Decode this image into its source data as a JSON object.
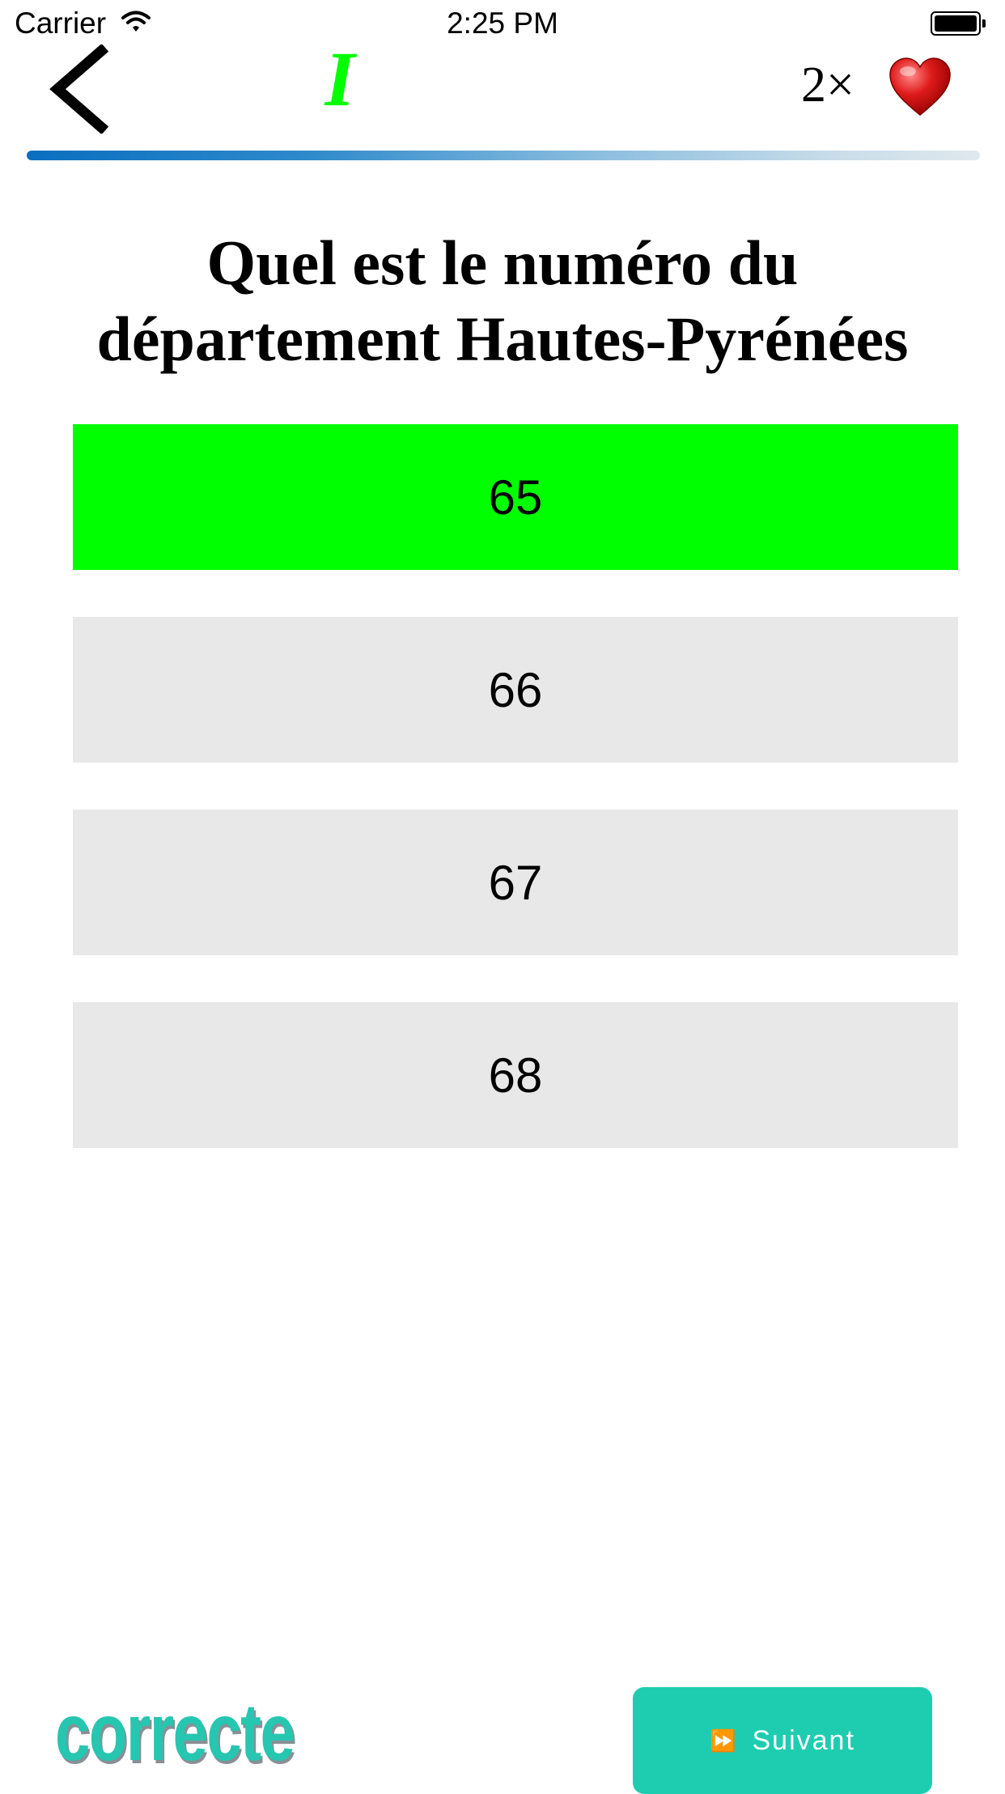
{
  "status_bar": {
    "carrier": "Carrier",
    "time": "2:25 PM"
  },
  "header": {
    "level": "I",
    "lives": "2×"
  },
  "quiz": {
    "question_lines": [
      "Quel est le numéro du",
      "département Hautes-Pyrénées"
    ],
    "answers": [
      {
        "label": "65",
        "state": "correct"
      },
      {
        "label": "66",
        "state": "neutral"
      },
      {
        "label": "67",
        "state": "neutral"
      },
      {
        "label": "68",
        "state": "neutral"
      }
    ]
  },
  "footer": {
    "result": "correcte",
    "next_label": "Suivant"
  },
  "colors": {
    "correct": "#00ff00",
    "answer_bg": "#e8e8e8",
    "accent": "#1ecdb0",
    "result_text": "#26c6b1"
  }
}
